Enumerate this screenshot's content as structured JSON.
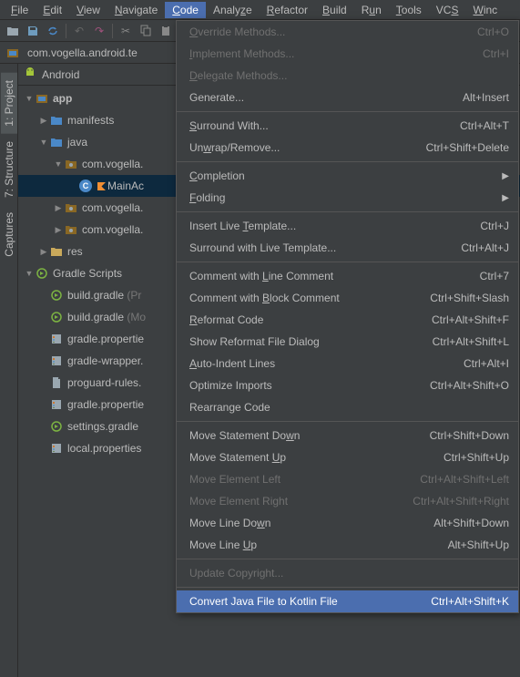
{
  "menubar": {
    "items": [
      {
        "label": "File",
        "accel": "F"
      },
      {
        "label": "Edit",
        "accel": "E"
      },
      {
        "label": "View",
        "accel": "V"
      },
      {
        "label": "Navigate",
        "accel": "N"
      },
      {
        "label": "Code",
        "accel": "C",
        "active": true
      },
      {
        "label": "Analyze",
        "accel": "z"
      },
      {
        "label": "Refactor",
        "accel": "R"
      },
      {
        "label": "Build",
        "accel": "B"
      },
      {
        "label": "Run",
        "accel": "u"
      },
      {
        "label": "Tools",
        "accel": "T"
      },
      {
        "label": "VCS",
        "accel": "S"
      },
      {
        "label": "Window",
        "accel": "W"
      }
    ]
  },
  "breadcrumb": {
    "text": "com.vogella.android.te"
  },
  "left_strip": {
    "tabs": [
      {
        "label": "1: Project",
        "active": true
      },
      {
        "label": "7: Structure"
      },
      {
        "label": "Captures"
      }
    ]
  },
  "panel": {
    "header": "Android"
  },
  "tree": {
    "app": "app",
    "manifests": "manifests",
    "java": "java",
    "pkg1": "com.vogella.",
    "main_activity": "MainAc",
    "pkg2": "com.vogella.",
    "pkg3": "com.vogella.",
    "res": "res",
    "gradle_scripts": "Gradle Scripts",
    "build_gradle_1": "build.gradle ",
    "build_gradle_1_hint": "(Pr",
    "build_gradle_2": "build.gradle ",
    "build_gradle_2_hint": "(Mo",
    "gradle_props_1": "gradle.propertie",
    "gradle_wrapper": "gradle-wrapper.",
    "proguard": "proguard-rules.",
    "gradle_props_2": "gradle.propertie",
    "settings_gradle": "settings.gradle",
    "local_props": "local.properties"
  },
  "dropdown": {
    "items": [
      {
        "label": "Override Methods...",
        "accel": "O",
        "shortcut": "Ctrl+O",
        "disabled": true
      },
      {
        "label": "Implement Methods...",
        "accel": "I",
        "shortcut": "Ctrl+I",
        "disabled": true
      },
      {
        "label": "Delegate Methods...",
        "accel": "D",
        "disabled": true
      },
      {
        "label": "Generate...",
        "shortcut": "Alt+Insert"
      },
      {
        "sep": true
      },
      {
        "label": "Surround With...",
        "accel": "S",
        "shortcut": "Ctrl+Alt+T"
      },
      {
        "label": "Unwrap/Remove...",
        "accel": "w",
        "shortcut": "Ctrl+Shift+Delete"
      },
      {
        "sep": true
      },
      {
        "label": "Completion",
        "accel": "C",
        "submenu": true
      },
      {
        "label": "Folding",
        "accel": "F",
        "submenu": true
      },
      {
        "sep": true
      },
      {
        "label": "Insert Live Template...",
        "accel": "T",
        "shortcut": "Ctrl+J"
      },
      {
        "label": "Surround with Live Template...",
        "shortcut": "Ctrl+Alt+J"
      },
      {
        "sep": true
      },
      {
        "label": "Comment with Line Comment",
        "accel": "L",
        "shortcut": "Ctrl+7"
      },
      {
        "label": "Comment with Block Comment",
        "accel": "B",
        "shortcut": "Ctrl+Shift+Slash"
      },
      {
        "label": "Reformat Code",
        "accel": "R",
        "shortcut": "Ctrl+Alt+Shift+F"
      },
      {
        "label": "Show Reformat File Dialog",
        "shortcut": "Ctrl+Alt+Shift+L"
      },
      {
        "label": "Auto-Indent Lines",
        "accel": "A",
        "shortcut": "Ctrl+Alt+I"
      },
      {
        "label": "Optimize Imports",
        "shortcut": "Ctrl+Alt+Shift+O"
      },
      {
        "label": "Rearrange Code"
      },
      {
        "sep": true
      },
      {
        "label": "Move Statement Down",
        "accel": "w",
        "shortcut": "Ctrl+Shift+Down"
      },
      {
        "label": "Move Statement Up",
        "accel": "U",
        "shortcut": "Ctrl+Shift+Up"
      },
      {
        "label": "Move Element Left",
        "shortcut": "Ctrl+Alt+Shift+Left",
        "disabled": true
      },
      {
        "label": "Move Element Right",
        "shortcut": "Ctrl+Alt+Shift+Right",
        "disabled": true
      },
      {
        "label": "Move Line Down",
        "accel": "w",
        "shortcut": "Alt+Shift+Down"
      },
      {
        "label": "Move Line Up",
        "accel": "U",
        "shortcut": "Alt+Shift+Up"
      },
      {
        "sep": true
      },
      {
        "label": "Update Copyright...",
        "disabled": true
      },
      {
        "sep": true
      },
      {
        "label": "Convert Java File to Kotlin File",
        "shortcut": "Ctrl+Alt+Shift+K",
        "highlighted": true
      }
    ]
  }
}
